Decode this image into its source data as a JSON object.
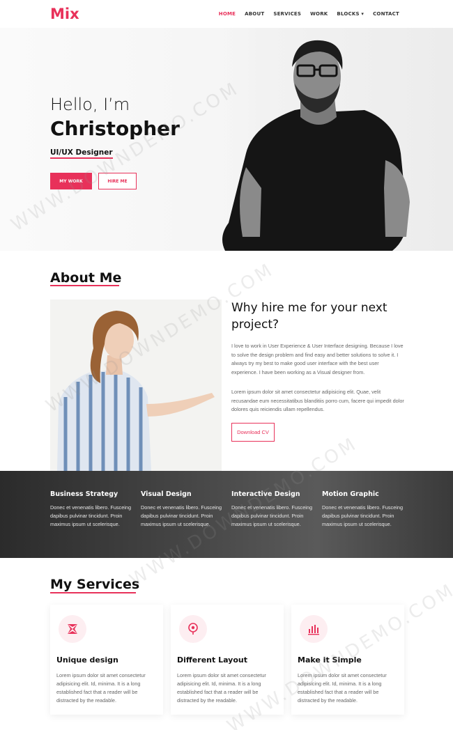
{
  "brand": {
    "logo": "Mix",
    "accent_color": "#e8315a"
  },
  "nav": {
    "items": [
      {
        "label": "HOME",
        "active": true
      },
      {
        "label": "ABOUT"
      },
      {
        "label": "SERVICES"
      },
      {
        "label": "WORK"
      },
      {
        "label": "BLOCKS ▾"
      },
      {
        "label": "CONTACT"
      }
    ]
  },
  "hero": {
    "greeting": "Hello, I’m",
    "name": "Christopher",
    "role": "UI/UX Designer",
    "primary_button": "MY WORK",
    "secondary_button": "HIRE ME"
  },
  "about": {
    "title": "About Me",
    "heading": "Why hire me for your next project?",
    "paragraph1": "I love to work in User Experience & User Interface designing. Because I love to solve the design problem and find easy and better solutions to solve it. I always try my best to make good user interface with the best user experience. I have been working as a Visual designer from.",
    "paragraph2": "Lorem ipsum dolor sit amet consectetur adipisicing elit. Quae, velit recusandae eum necessitatibus blanditiis porro cum, facere qui impedit dolor dolores quis reiciendis ullam repellendus.",
    "cv_button": "Download CV"
  },
  "skills": [
    {
      "title": "Business Strategy",
      "text": "Donec et venenatis libero. Fusceing dapibus pulvinar tincidunt. Proin maximus ipsum ut scelerisque."
    },
    {
      "title": "Visual Design",
      "text": "Donec et venenatis libero. Fusceing dapibus pulvinar tincidunt. Proin maximus ipsum ut scelerisque."
    },
    {
      "title": "Interactive Design",
      "text": "Donec et venenatis libero. Fusceing dapibus pulvinar tincidunt. Proin maximus ipsum ut scelerisque."
    },
    {
      "title": "Motion Graphic",
      "text": "Donec et venenatis libero. Fusceing dapibus pulvinar tincidunt. Proin maximus ipsum ut scelerisque."
    }
  ],
  "services": {
    "title": "My Services",
    "cards": [
      {
        "icon": "design-icon",
        "title": "Unique design",
        "text": "Lorem ipsum dolor sit amet consectetur adipisicing elit. Id, minima. It is a long established fact that a reader will be distracted by the readable."
      },
      {
        "icon": "layout-icon",
        "title": "Different Layout",
        "text": "Lorem ipsum dolor sit amet consectetur adipisicing elit. Id, minima. It is a long established fact that a reader will be distracted by the readable."
      },
      {
        "icon": "chart-icon",
        "title": "Make it Simple",
        "text": "Lorem ipsum dolor sit amet consectetur adipisicing elit. Id, minima. It is a long established fact that a reader will be distracted by the readable."
      }
    ]
  },
  "watermark": "WWW.DOWNDEMO.COM"
}
